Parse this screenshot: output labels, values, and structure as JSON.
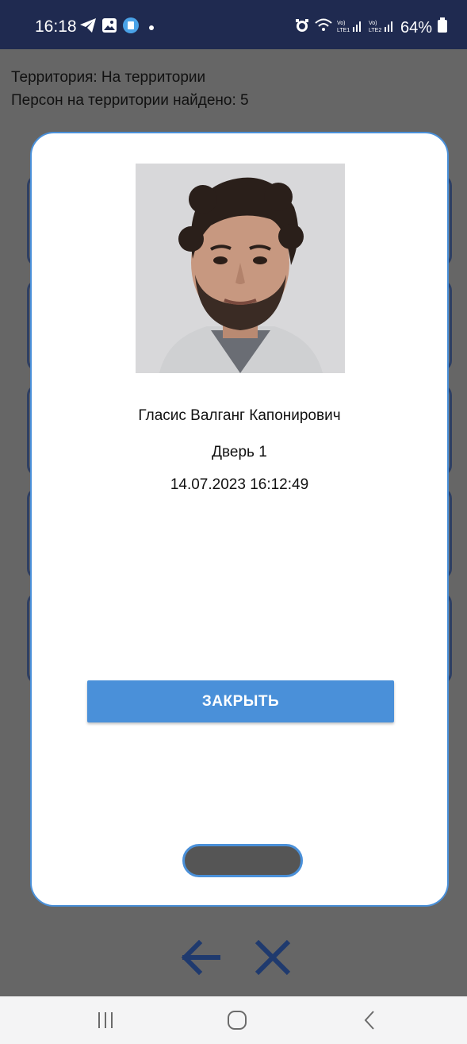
{
  "status_bar": {
    "time": "16:18",
    "battery": "64%",
    "left_icons": [
      "telegram-icon",
      "gallery-icon",
      "app-icon",
      "notification-dot-icon"
    ],
    "right_icons": [
      "alarm-icon",
      "wifi-icon",
      "volte-lte1-signal-icon",
      "volte-lte2-signal-icon",
      "battery-icon"
    ]
  },
  "territory": {
    "line1": "Территория: На территории",
    "line2": "Персон на территории найдено: 5"
  },
  "modal": {
    "person_name": "Гласис Валганг Капонирович",
    "door": "Дверь 1",
    "datetime": "14.07.2023 16:12:49",
    "close_label": "ЗАКРЫТЬ"
  },
  "bottom_actions": [
    "back-arrow-icon",
    "close-icon"
  ],
  "nav_bar": [
    "recent-apps-icon",
    "home-icon",
    "back-icon"
  ],
  "colors": {
    "accent": "#4a90d9",
    "status_bar": "#1f2a50",
    "overlay": "#666666",
    "action_icons": "#1f3a6e"
  }
}
